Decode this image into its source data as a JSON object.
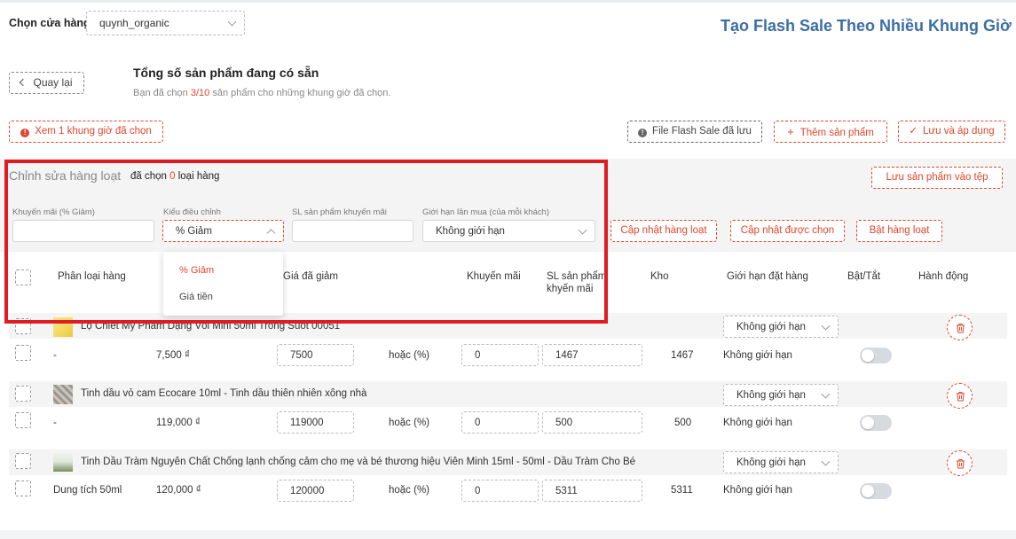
{
  "store": {
    "label": "Chọn cửa hàng",
    "value": "quynh_organic"
  },
  "title": "Tạo Flash Sale Theo Nhiều Khung Giờ",
  "back_label": "Quay lại",
  "summary": {
    "title": "Tổng số sản phẩm đang có sẵn",
    "sub_prefix": "Bạn đã chọn ",
    "sub_count": "3/10",
    "sub_suffix": " sản phẩm cho những khung giờ đã chọn."
  },
  "buttons": {
    "view_slots": "Xem 1 khung giờ đã chọn",
    "saved_file": "File Flash Sale đã lưu",
    "add_product": "Thêm sản phẩm",
    "save_apply": "Lưu và áp dụng",
    "save_to_file": "Lưu sản phẩm vào tệp",
    "bulk_update": "Cập nhật hàng loạt",
    "update_selected": "Cập nhật được chọn",
    "enable_bulk": "Bật hàng loạt"
  },
  "bulk": {
    "title": "Chỉnh sửa hàng loạt",
    "count_prefix": "đã chọn ",
    "count": "0",
    "count_suffix": " loại hàng",
    "discount_label": "Khuyến mãi (% Giảm)",
    "adjust_label": "Kiểu điều chỉnh",
    "adjust_value": "% Giảm",
    "qty_label": "SL sản phẩm khuyến mãi",
    "limit_label": "Giới hạn lần mua (của mỗi khách)",
    "limit_value": "Không giới hạn"
  },
  "dropdown": {
    "options": [
      "% Giảm",
      "Giá tiền"
    ],
    "selected": "% Giảm"
  },
  "columns": {
    "variant": "Phân loại hàng",
    "sale_price": "Giá đã giảm",
    "discount": "Khuyến mãi",
    "qty_line1": "SL sản phẩm",
    "qty_line2": "khyến mãi",
    "stock": "Kho",
    "order_limit": "Giới hạn đặt hàng",
    "toggle": "Bật/Tắt",
    "action": "Hành động"
  },
  "products": [
    {
      "name": "Lọ Chiết Mỹ Phẩm Dạng Vòi Mini 50ml Trong Suốt 00051",
      "limit": "Không giới hạn",
      "variant": "-",
      "price": "7,500 ₫",
      "sale_price": "7500",
      "or_label": "hoặc (%)",
      "discount": "0",
      "qty": "1467",
      "stock": "1467",
      "row_limit": "Không giới hạn"
    },
    {
      "name": "Tinh dầu vỏ cam Ecocare 10ml - Tinh dầu thiên nhiên xông nhà",
      "limit": "Không giới hạn",
      "variant": "-",
      "price": "119,000 ₫",
      "sale_price": "119000",
      "or_label": "hoặc (%)",
      "discount": "0",
      "qty": "500",
      "stock": "500",
      "row_limit": "Không giới hạn"
    },
    {
      "name": "Tinh Dầu Tràm Nguyên Chất Chống lạnh chống cảm cho mẹ và bé thương hiệu Viên Minh 15ml - 50ml - Dầu Tràm Cho Bé",
      "limit": "Không giới hạn",
      "variant": "Dung tích 50ml",
      "price": "120,000 ₫",
      "sale_price": "120000",
      "or_label": "hoặc (%)",
      "discount": "0",
      "qty": "5311",
      "stock": "5311",
      "row_limit": "Không giới hạn"
    }
  ],
  "colors": {
    "accent": "#e0462d",
    "title": "#3c6ea5",
    "highlight": "#e01b24"
  }
}
